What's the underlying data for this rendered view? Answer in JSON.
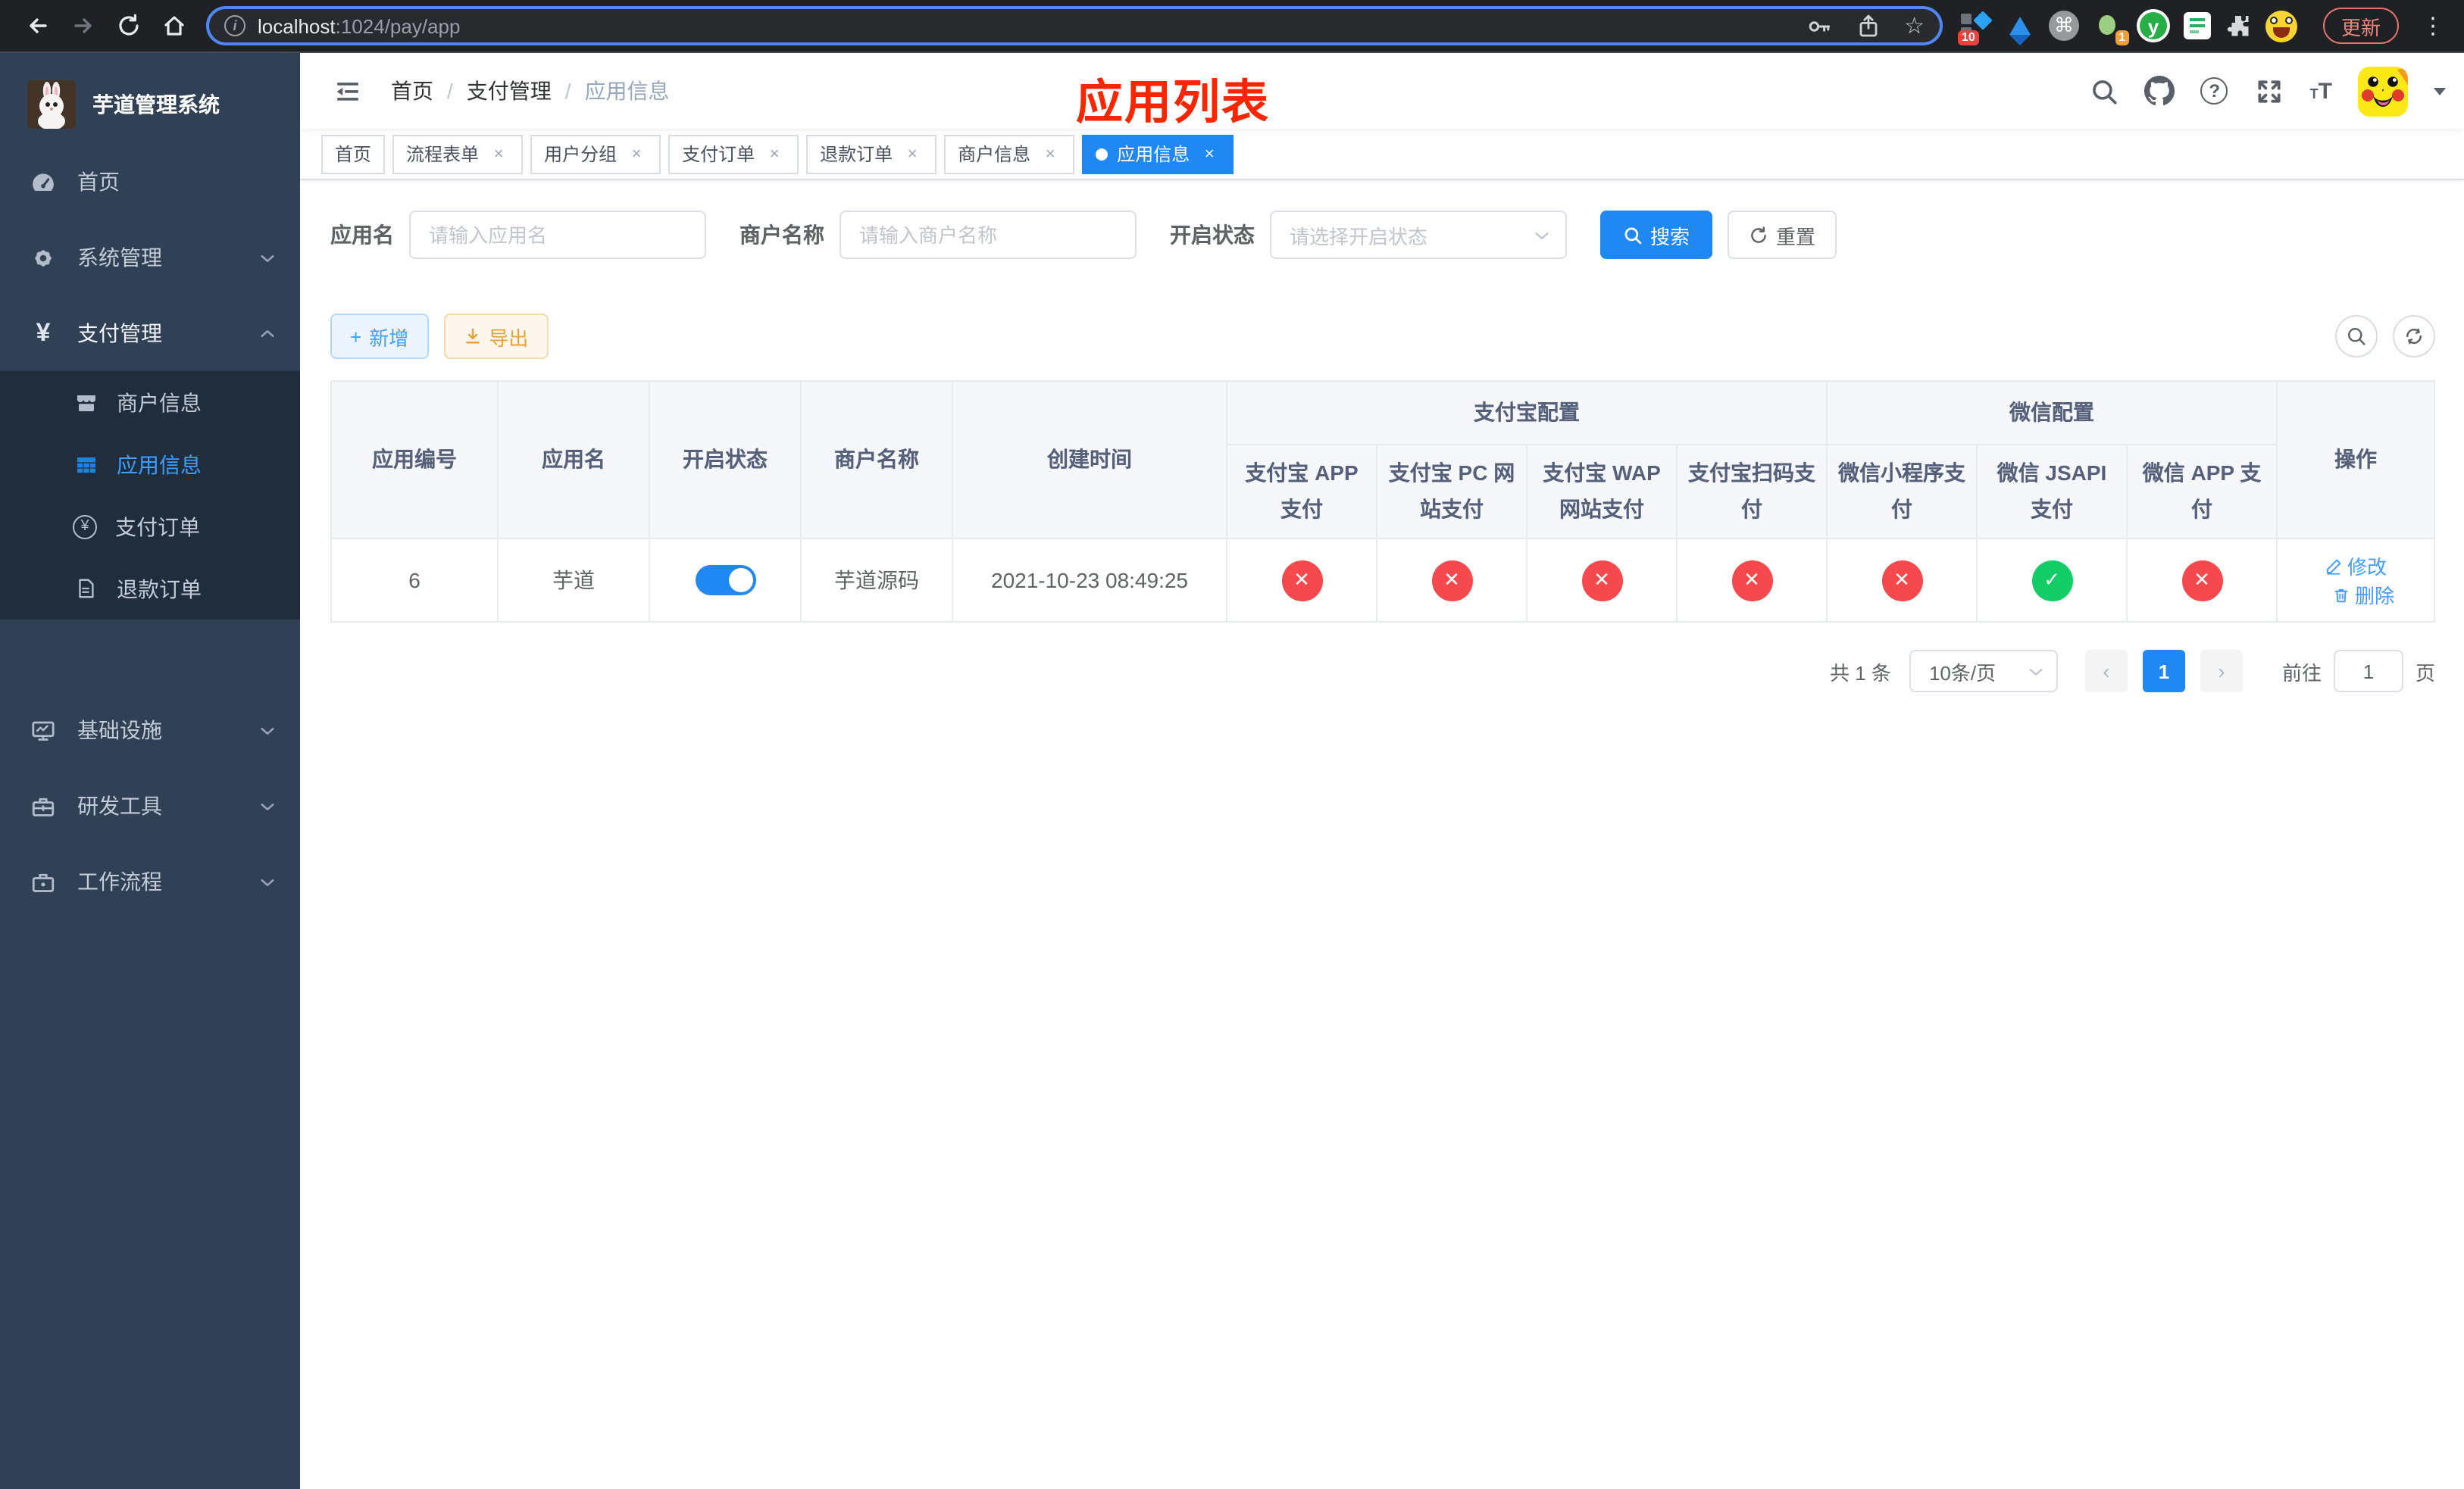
{
  "icons": {
    "check": "✓",
    "cross": "✕",
    "close": "×",
    "dot": "●",
    "chevron_left": "‹",
    "chevron_right": "›",
    "cmd_glyph": "⌘",
    "yen_glyph": "¥",
    "plus": "+",
    "kebab": "⋮",
    "star": "☆",
    "info": "i",
    "question": "?",
    "y_letter": "y",
    "font_small": "T",
    "font_big": "T"
  },
  "browser": {
    "url_host": "localhost",
    "url_path": ":1024/pay/app",
    "update_label": "更新",
    "ext_badges": {
      "pinned": "10",
      "tab_count": "1"
    }
  },
  "sidebar": {
    "app_title": "芋道管理系统",
    "menu": [
      {
        "label": "首页"
      },
      {
        "label": "系统管理"
      },
      {
        "label": "支付管理"
      },
      {
        "label": "基础设施"
      },
      {
        "label": "研发工具"
      },
      {
        "label": "工作流程"
      }
    ],
    "submenu": [
      {
        "label": "商户信息"
      },
      {
        "label": "应用信息"
      },
      {
        "label": "支付订单"
      },
      {
        "label": "退款订单"
      }
    ]
  },
  "header": {
    "breadcrumb": [
      "首页",
      "支付管理",
      "应用信息"
    ],
    "breadcrumb_sep": "/",
    "annotation": "应用列表"
  },
  "tabs": [
    {
      "label": "首页"
    },
    {
      "label": "流程表单"
    },
    {
      "label": "用户分组"
    },
    {
      "label": "支付订单"
    },
    {
      "label": "退款订单"
    },
    {
      "label": "商户信息"
    },
    {
      "label": "应用信息"
    }
  ],
  "filters": {
    "app_name_label": "应用名",
    "app_name_placeholder": "请输入应用名",
    "merchant_label": "商户名称",
    "merchant_placeholder": "请输入商户名称",
    "status_label": "开启状态",
    "status_placeholder": "请选择开启状态",
    "search_label": "搜索",
    "reset_label": "重置"
  },
  "toolbar": {
    "add_label": "新增",
    "export_label": "导出"
  },
  "table": {
    "columns_left": [
      "应用编号",
      "应用名",
      "开启状态",
      "商户名称",
      "创建时间"
    ],
    "groups": [
      {
        "label": "支付宝配置"
      },
      {
        "label": "微信配置"
      }
    ],
    "subcolumns": [
      "支付宝 APP 支付",
      "支付宝 PC 网站支付",
      "支付宝 WAP 网站支付",
      "支付宝扫码支付",
      "微信小程序支付",
      "微信 JSAPI 支付",
      "微信 APP 支付"
    ],
    "action_column": "操作",
    "rows": [
      {
        "id": "6",
        "name": "芋道",
        "enabled": "on",
        "merchant": "芋道源码",
        "created_at": "2021-10-23 08:49:25",
        "pay_status": [
          "no",
          "no",
          "no",
          "no",
          "no",
          "yes",
          "no"
        ],
        "edit_label": "修改",
        "delete_label": "删除"
      }
    ]
  },
  "pagination": {
    "total_label": "共 1 条",
    "page_size_label": "10条/页",
    "current_page": "1",
    "goto_label": "前往",
    "goto_value": "1",
    "unit_label": "页"
  },
  "colors": {
    "primary": "#2088f2",
    "link": "#409eff",
    "success": "#13ce66",
    "danger": "#f5494d",
    "sidebar_bg": "#304156",
    "sidebar_sub_bg": "#1f2d3d",
    "annotation": "#fb2500"
  }
}
